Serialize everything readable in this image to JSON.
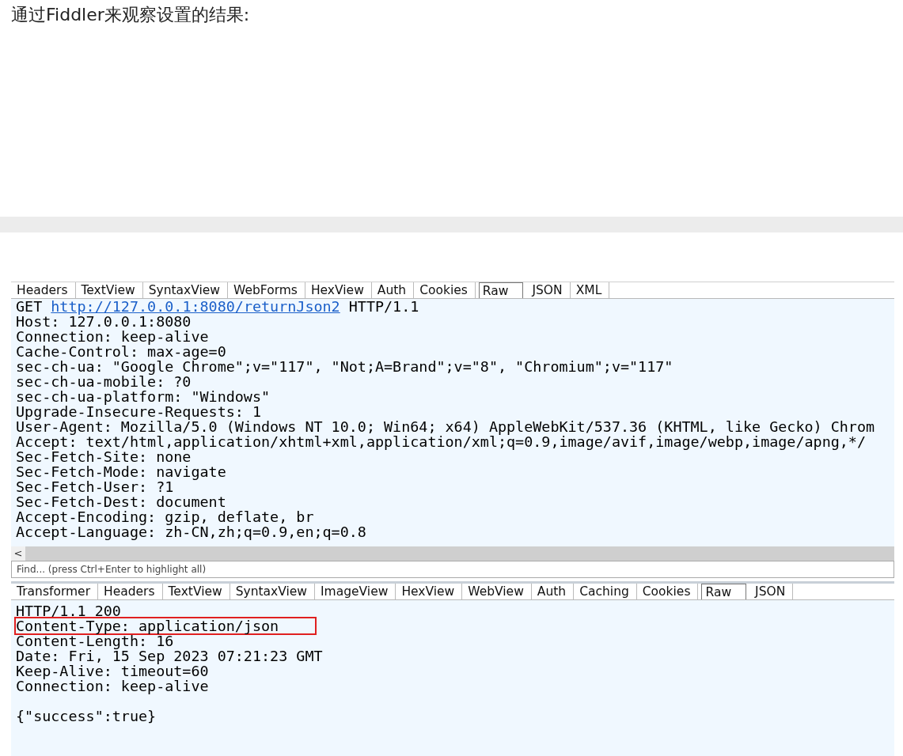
{
  "heading": "通过Fiddler来观察设置的结果:",
  "request": {
    "tabs": [
      {
        "label": "Headers",
        "selected": false
      },
      {
        "label": "TextView",
        "selected": false
      },
      {
        "label": "SyntaxView",
        "selected": false
      },
      {
        "label": "WebForms",
        "selected": false
      },
      {
        "label": "HexView",
        "selected": false
      },
      {
        "label": "Auth",
        "selected": false
      },
      {
        "label": "Cookies",
        "selected": false
      },
      {
        "label": "Raw",
        "selected": true
      },
      {
        "label": "JSON",
        "selected": false
      },
      {
        "label": "XML",
        "selected": false
      }
    ],
    "request_line": {
      "method": "GET",
      "url": "http://127.0.0.1:8080/returnJson2",
      "version": "HTTP/1.1"
    },
    "lines": [
      "Host: 127.0.0.1:8080",
      "Connection: keep-alive",
      "Cache-Control: max-age=0",
      "sec-ch-ua: \"Google Chrome\";v=\"117\", \"Not;A=Brand\";v=\"8\", \"Chromium\";v=\"117\"",
      "sec-ch-ua-mobile: ?0",
      "sec-ch-ua-platform: \"Windows\"",
      "Upgrade-Insecure-Requests: 1",
      "User-Agent: Mozilla/5.0 (Windows NT 10.0; Win64; x64) AppleWebKit/537.36 (KHTML, like Gecko) Chrom",
      "Accept: text/html,application/xhtml+xml,application/xml;q=0.9,image/avif,image/webp,image/apng,*/",
      "Sec-Fetch-Site: none",
      "Sec-Fetch-Mode: navigate",
      "Sec-Fetch-User: ?1",
      "Sec-Fetch-Dest: document",
      "Accept-Encoding: gzip, deflate, br",
      "Accept-Language: zh-CN,zh;q=0.9,en;q=0.8"
    ],
    "scroll_left": "<",
    "find": {
      "placeholder": "Find... (press Ctrl+Enter to highlight all)"
    }
  },
  "response": {
    "tabs": [
      {
        "label": "Transformer",
        "selected": false
      },
      {
        "label": "Headers",
        "selected": false
      },
      {
        "label": "TextView",
        "selected": false
      },
      {
        "label": "SyntaxView",
        "selected": false
      },
      {
        "label": "ImageView",
        "selected": false
      },
      {
        "label": "HexView",
        "selected": false
      },
      {
        "label": "WebView",
        "selected": false
      },
      {
        "label": "Auth",
        "selected": false
      },
      {
        "label": "Caching",
        "selected": false
      },
      {
        "label": "Cookies",
        "selected": false
      },
      {
        "label": "Raw",
        "selected": true
      },
      {
        "label": "JSON",
        "selected": false
      }
    ],
    "lines": [
      {
        "text": "HTTP/1.1 200",
        "highlighted": false
      },
      {
        "text": "Content-Type: application/json",
        "highlighted": true
      },
      {
        "text": "Content-Length: 16",
        "highlighted": false
      },
      {
        "text": "Date: Fri, 15 Sep 2023 07:21:23 GMT",
        "highlighted": false
      },
      {
        "text": "Keep-Alive: timeout=60",
        "highlighted": false
      },
      {
        "text": "Connection: keep-alive",
        "highlighted": false
      }
    ],
    "body": "{\"success\":true}"
  }
}
